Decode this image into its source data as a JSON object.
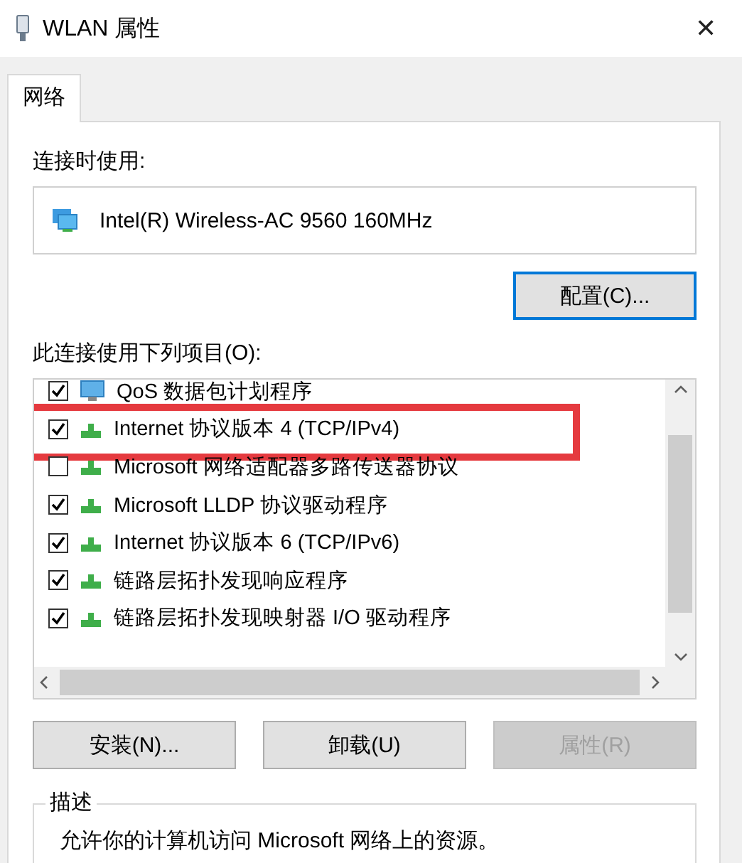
{
  "window": {
    "title": "WLAN 属性",
    "close": "✕"
  },
  "tabs": [
    {
      "label": "网络",
      "selected": true
    }
  ],
  "connect_using": {
    "label": "连接时使用:",
    "adapter": "Intel(R) Wireless-AC 9560 160MHz",
    "configure_button": "配置(C)..."
  },
  "items_label": "此连接使用下列项目(O):",
  "items": [
    {
      "label": "QoS 数据包计划程序",
      "checked": true,
      "kind": "service",
      "highlighted": false
    },
    {
      "label": "Internet 协议版本 4 (TCP/IPv4)",
      "checked": true,
      "kind": "protocol",
      "highlighted": true
    },
    {
      "label": "Microsoft 网络适配器多路传送器协议",
      "checked": false,
      "kind": "protocol",
      "highlighted": false
    },
    {
      "label": "Microsoft LLDP 协议驱动程序",
      "checked": true,
      "kind": "protocol",
      "highlighted": false
    },
    {
      "label": "Internet 协议版本 6 (TCP/IPv6)",
      "checked": true,
      "kind": "protocol",
      "highlighted": false
    },
    {
      "label": "链路层拓扑发现响应程序",
      "checked": true,
      "kind": "protocol",
      "highlighted": false
    },
    {
      "label": "链路层拓扑发现映射器 I/O 驱动程序",
      "checked": true,
      "kind": "protocol",
      "highlighted": false
    }
  ],
  "buttons": [
    {
      "label": "安装(N)...",
      "disabled": false
    },
    {
      "label": "卸载(U)",
      "disabled": false
    },
    {
      "label": "属性(R)",
      "disabled": true
    }
  ],
  "description": {
    "title": "描述",
    "text": "允许你的计算机访问 Microsoft 网络上的资源。"
  }
}
